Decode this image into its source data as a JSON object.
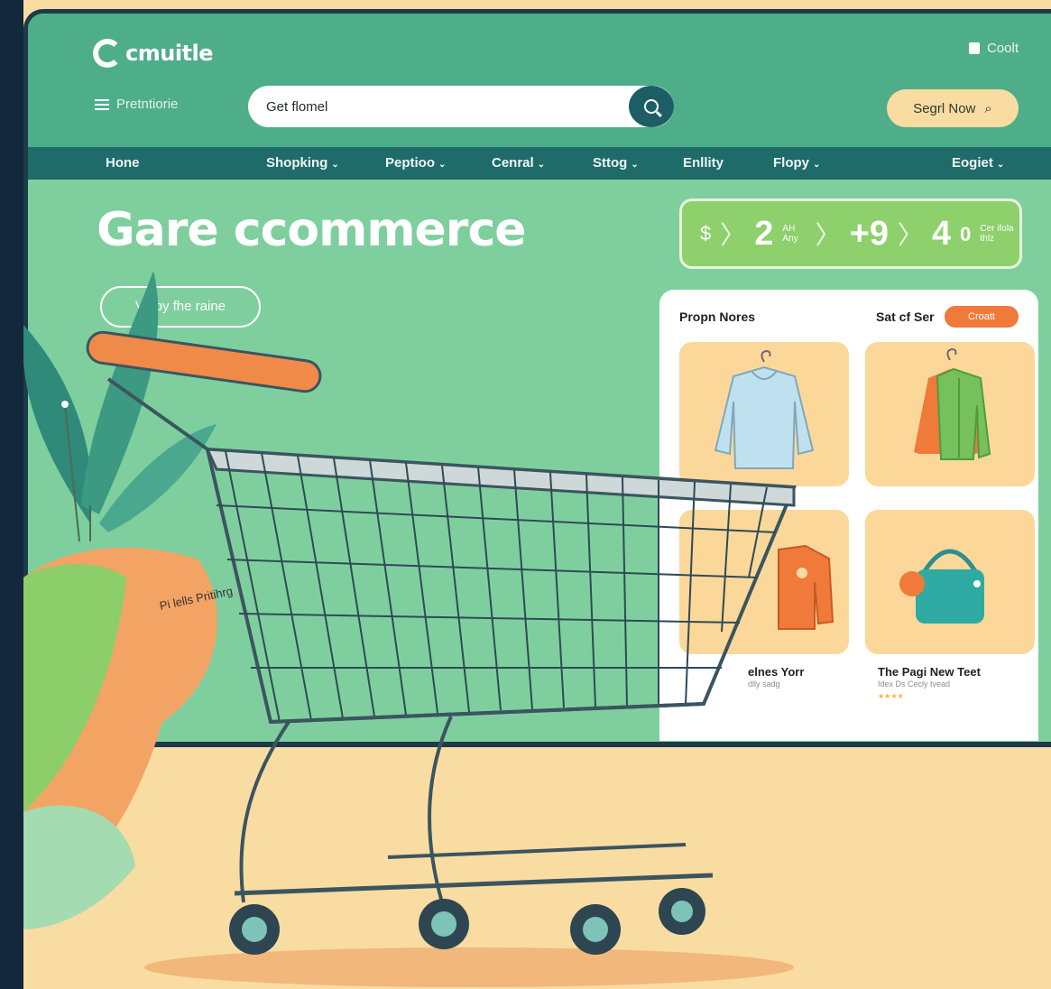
{
  "header": {
    "logo_text": "cmuitle",
    "cookie_label": "Coolt",
    "menu_label": "Pretntiorie",
    "search_value": "Get flomel",
    "cta_label": "Segrl Now"
  },
  "nav": {
    "items": [
      {
        "label": "Hone",
        "chevron": false
      },
      {
        "label": "Shopking",
        "chevron": true
      },
      {
        "label": "Peptioo",
        "chevron": true
      },
      {
        "label": "Cenral",
        "chevron": true
      },
      {
        "label": "Sttog",
        "chevron": true
      },
      {
        "label": "Enllity",
        "chevron": false
      },
      {
        "label": "Flopy",
        "chevron": true
      },
      {
        "label": "Eogiet",
        "chevron": true
      }
    ]
  },
  "hero": {
    "title": "Gare ccommerce",
    "button_label": "Vlepy fhe raine"
  },
  "stats": {
    "currency": "$",
    "value1": "2",
    "value1_sub": "AH Any",
    "value2": "+9",
    "value3": "4",
    "value3_sub": "0",
    "value3_note": "Cer ifola thlz"
  },
  "panel": {
    "title": "Propn Nores",
    "title2": "Sat cf Ser",
    "badge": "Croatt",
    "tile3_label": "elnes Yorr",
    "tile3_sub": "dlly sadg",
    "tile4_label": "The Pagi New Teet",
    "tile4_sub": "Idex Ds Cecly tvead",
    "tile4_stars": "★★★★"
  },
  "sign": {
    "text": "Pi lells Pritihrg"
  },
  "colors": {
    "header": "#4fae8a",
    "nav": "#1f6b6a",
    "hero_bg": "#7fcf9e",
    "accent": "#f07a3a",
    "floor": "#f9dca2",
    "frame": "#1d3a4a"
  }
}
